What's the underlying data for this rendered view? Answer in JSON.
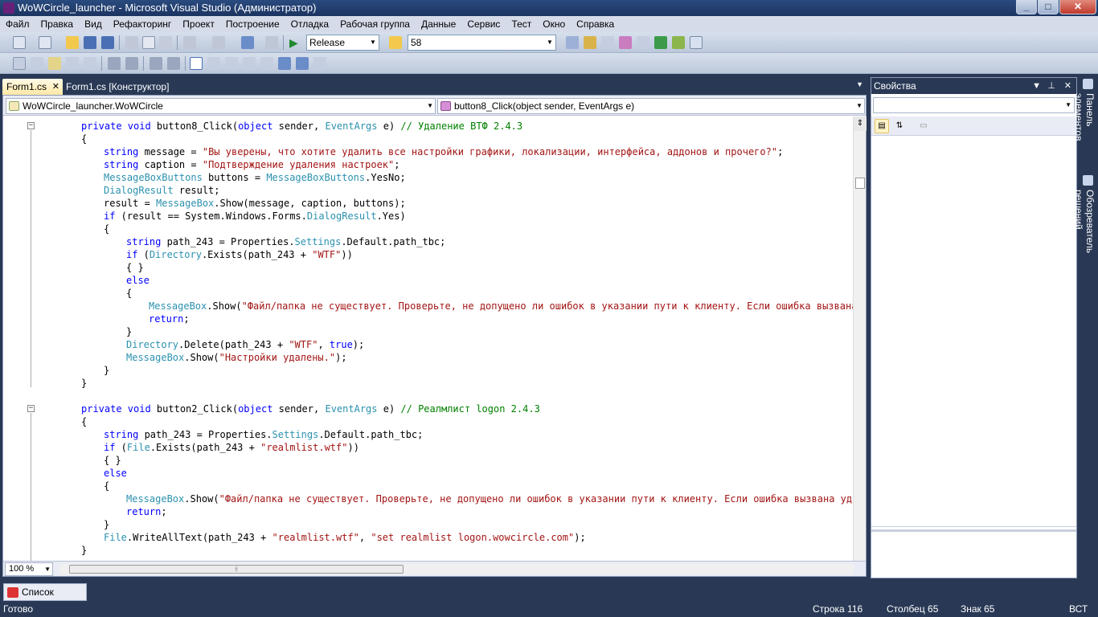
{
  "window": {
    "title": "WoWCircle_launcher - Microsoft Visual Studio (Администратор)",
    "buttons": {
      "minimize": "_",
      "maximize": "□",
      "close": "✕"
    }
  },
  "menu": [
    "Файл",
    "Правка",
    "Вид",
    "Рефакторинг",
    "Проект",
    "Построение",
    "Отладка",
    "Рабочая группа",
    "Данные",
    "Сервис",
    "Тест",
    "Окно",
    "Справка"
  ],
  "toolbar": {
    "configuration": "Release",
    "find_value": "58"
  },
  "tabs": {
    "active": "Form1.cs",
    "active_close": "✕",
    "other": "Form1.cs [Конструктор]"
  },
  "navigation": {
    "class_selector": "WoWCircle_launcher.WoWCircle",
    "member_selector": "button8_Click(object sender, EventArgs e)"
  },
  "code_lines": [
    {
      "indent": 2,
      "tokens": [
        [
          "kw",
          "private "
        ],
        [
          "kw",
          "void "
        ],
        [
          "",
          "button8_Click("
        ],
        [
          "kw",
          "object"
        ],
        [
          "",
          " sender, "
        ],
        [
          "ty",
          "EventArgs"
        ],
        [
          "",
          " e) "
        ],
        [
          "cm",
          "// Удаление ВТФ 2.4.3"
        ]
      ]
    },
    {
      "indent": 2,
      "tokens": [
        [
          "",
          "{"
        ]
      ]
    },
    {
      "indent": 3,
      "tokens": [
        [
          "kw",
          "string"
        ],
        [
          "",
          " message = "
        ],
        [
          "st",
          "\"Вы уверены, что хотите удалить все настройки графики, локализации, интерфейса, аддонов и прочего?\""
        ],
        [
          "",
          ";"
        ]
      ]
    },
    {
      "indent": 3,
      "tokens": [
        [
          "kw",
          "string"
        ],
        [
          "",
          " caption = "
        ],
        [
          "st",
          "\"Подтверждение удаления настроек\""
        ],
        [
          "",
          ";"
        ]
      ]
    },
    {
      "indent": 3,
      "tokens": [
        [
          "ty",
          "MessageBoxButtons"
        ],
        [
          "",
          " buttons = "
        ],
        [
          "ty",
          "MessageBoxButtons"
        ],
        [
          "",
          ".YesNo;"
        ]
      ]
    },
    {
      "indent": 3,
      "tokens": [
        [
          "ty",
          "DialogResult"
        ],
        [
          "",
          " result;"
        ]
      ]
    },
    {
      "indent": 3,
      "tokens": [
        [
          "",
          "result = "
        ],
        [
          "ty",
          "MessageBox"
        ],
        [
          "",
          ".Show(message, caption, buttons);"
        ]
      ]
    },
    {
      "indent": 3,
      "tokens": [
        [
          "kw",
          "if"
        ],
        [
          "",
          " (result == System.Windows.Forms."
        ],
        [
          "ty",
          "DialogResult"
        ],
        [
          "",
          ".Yes)"
        ]
      ]
    },
    {
      "indent": 3,
      "tokens": [
        [
          "",
          "{"
        ]
      ]
    },
    {
      "indent": 4,
      "tokens": [
        [
          "kw",
          "string"
        ],
        [
          "",
          " path_243 = Properties."
        ],
        [
          "ty",
          "Settings"
        ],
        [
          "",
          ".Default.path_tbc;"
        ]
      ]
    },
    {
      "indent": 4,
      "tokens": [
        [
          "kw",
          "if"
        ],
        [
          "",
          " ("
        ],
        [
          "ty",
          "Directory"
        ],
        [
          "",
          ".Exists(path_243 + "
        ],
        [
          "st",
          "\"WTF\""
        ],
        [
          "",
          "))"
        ]
      ]
    },
    {
      "indent": 4,
      "tokens": [
        [
          "",
          "{ }"
        ]
      ]
    },
    {
      "indent": 4,
      "tokens": [
        [
          "kw",
          "else"
        ]
      ]
    },
    {
      "indent": 4,
      "tokens": [
        [
          "",
          "{"
        ]
      ]
    },
    {
      "indent": 5,
      "tokens": [
        [
          "ty",
          "MessageBox"
        ],
        [
          "",
          ".Show("
        ],
        [
          "st",
          "\"Файл/папка не существует. Проверьте, не допущено ли ошибок в указании пути к клиенту. Если ошибка вызвана уда"
        ]
      ]
    },
    {
      "indent": 5,
      "tokens": [
        [
          "kw",
          "return"
        ],
        [
          "",
          ";"
        ]
      ]
    },
    {
      "indent": 4,
      "tokens": [
        [
          "",
          "}"
        ]
      ]
    },
    {
      "indent": 4,
      "tokens": [
        [
          "ty",
          "Directory"
        ],
        [
          "",
          ".Delete(path_243 + "
        ],
        [
          "st",
          "\"WTF\""
        ],
        [
          "",
          ", "
        ],
        [
          "kw",
          "true"
        ],
        [
          "",
          ");"
        ]
      ]
    },
    {
      "indent": 4,
      "tokens": [
        [
          "ty",
          "MessageBox"
        ],
        [
          "",
          ".Show("
        ],
        [
          "st",
          "\"Настройки удалены.\""
        ],
        [
          "",
          ");"
        ]
      ]
    },
    {
      "indent": 3,
      "tokens": [
        [
          "",
          "}"
        ]
      ]
    },
    {
      "indent": 2,
      "tokens": [
        [
          "",
          "}"
        ]
      ]
    },
    {
      "indent": 0,
      "tokens": []
    },
    {
      "indent": 2,
      "tokens": [
        [
          "kw",
          "private "
        ],
        [
          "kw",
          "void "
        ],
        [
          "",
          "button2_Click("
        ],
        [
          "kw",
          "object"
        ],
        [
          "",
          " sender, "
        ],
        [
          "ty",
          "EventArgs"
        ],
        [
          "",
          " e) "
        ],
        [
          "cm",
          "// Реалмлист logon 2.4.3"
        ]
      ]
    },
    {
      "indent": 2,
      "tokens": [
        [
          "",
          "{"
        ]
      ]
    },
    {
      "indent": 3,
      "tokens": [
        [
          "kw",
          "string"
        ],
        [
          "",
          " path_243 = Properties."
        ],
        [
          "ty",
          "Settings"
        ],
        [
          "",
          ".Default.path_tbc;"
        ]
      ]
    },
    {
      "indent": 3,
      "tokens": [
        [
          "kw",
          "if"
        ],
        [
          "",
          " ("
        ],
        [
          "ty",
          "File"
        ],
        [
          "",
          ".Exists(path_243 + "
        ],
        [
          "st",
          "\"realmlist.wtf\""
        ],
        [
          "",
          "))"
        ]
      ]
    },
    {
      "indent": 3,
      "tokens": [
        [
          "",
          "{ }"
        ]
      ]
    },
    {
      "indent": 3,
      "tokens": [
        [
          "kw",
          "else"
        ]
      ]
    },
    {
      "indent": 3,
      "tokens": [
        [
          "",
          "{"
        ]
      ]
    },
    {
      "indent": 4,
      "tokens": [
        [
          "ty",
          "MessageBox"
        ],
        [
          "",
          ".Show("
        ],
        [
          "st",
          "\"Файл/папка не существует. Проверьте, не допущено ли ошибок в указании пути к клиенту. Если ошибка вызвана удалени"
        ]
      ]
    },
    {
      "indent": 4,
      "tokens": [
        [
          "kw",
          "return"
        ],
        [
          "",
          ";"
        ]
      ]
    },
    {
      "indent": 3,
      "tokens": [
        [
          "",
          "}"
        ]
      ]
    },
    {
      "indent": 3,
      "tokens": [
        [
          "ty",
          "File"
        ],
        [
          "",
          ".WriteAllText(path_243 + "
        ],
        [
          "st",
          "\"realmlist.wtf\""
        ],
        [
          "",
          ", "
        ],
        [
          "st",
          "\"set realmlist logon.wowcircle.com\""
        ],
        [
          "",
          ");"
        ]
      ]
    },
    {
      "indent": 2,
      "tokens": [
        [
          "",
          "}"
        ]
      ]
    }
  ],
  "editor": {
    "zoom": "100 %",
    "colors": {
      "keyword": "#0000ff",
      "type": "#2b91af",
      "string": "#a31515",
      "comment": "#008000"
    }
  },
  "properties_panel": {
    "title": "Свойства",
    "pin": "⊥",
    "close": "✕"
  },
  "side_tabs": [
    "Панель элементов",
    "Обозреватель решений"
  ],
  "error_list": "Список ошибок",
  "status": {
    "state": "Готово",
    "line": "Строка 116",
    "column": "Столбец 65",
    "char": "Знак 65",
    "mode": "ВСТ"
  }
}
